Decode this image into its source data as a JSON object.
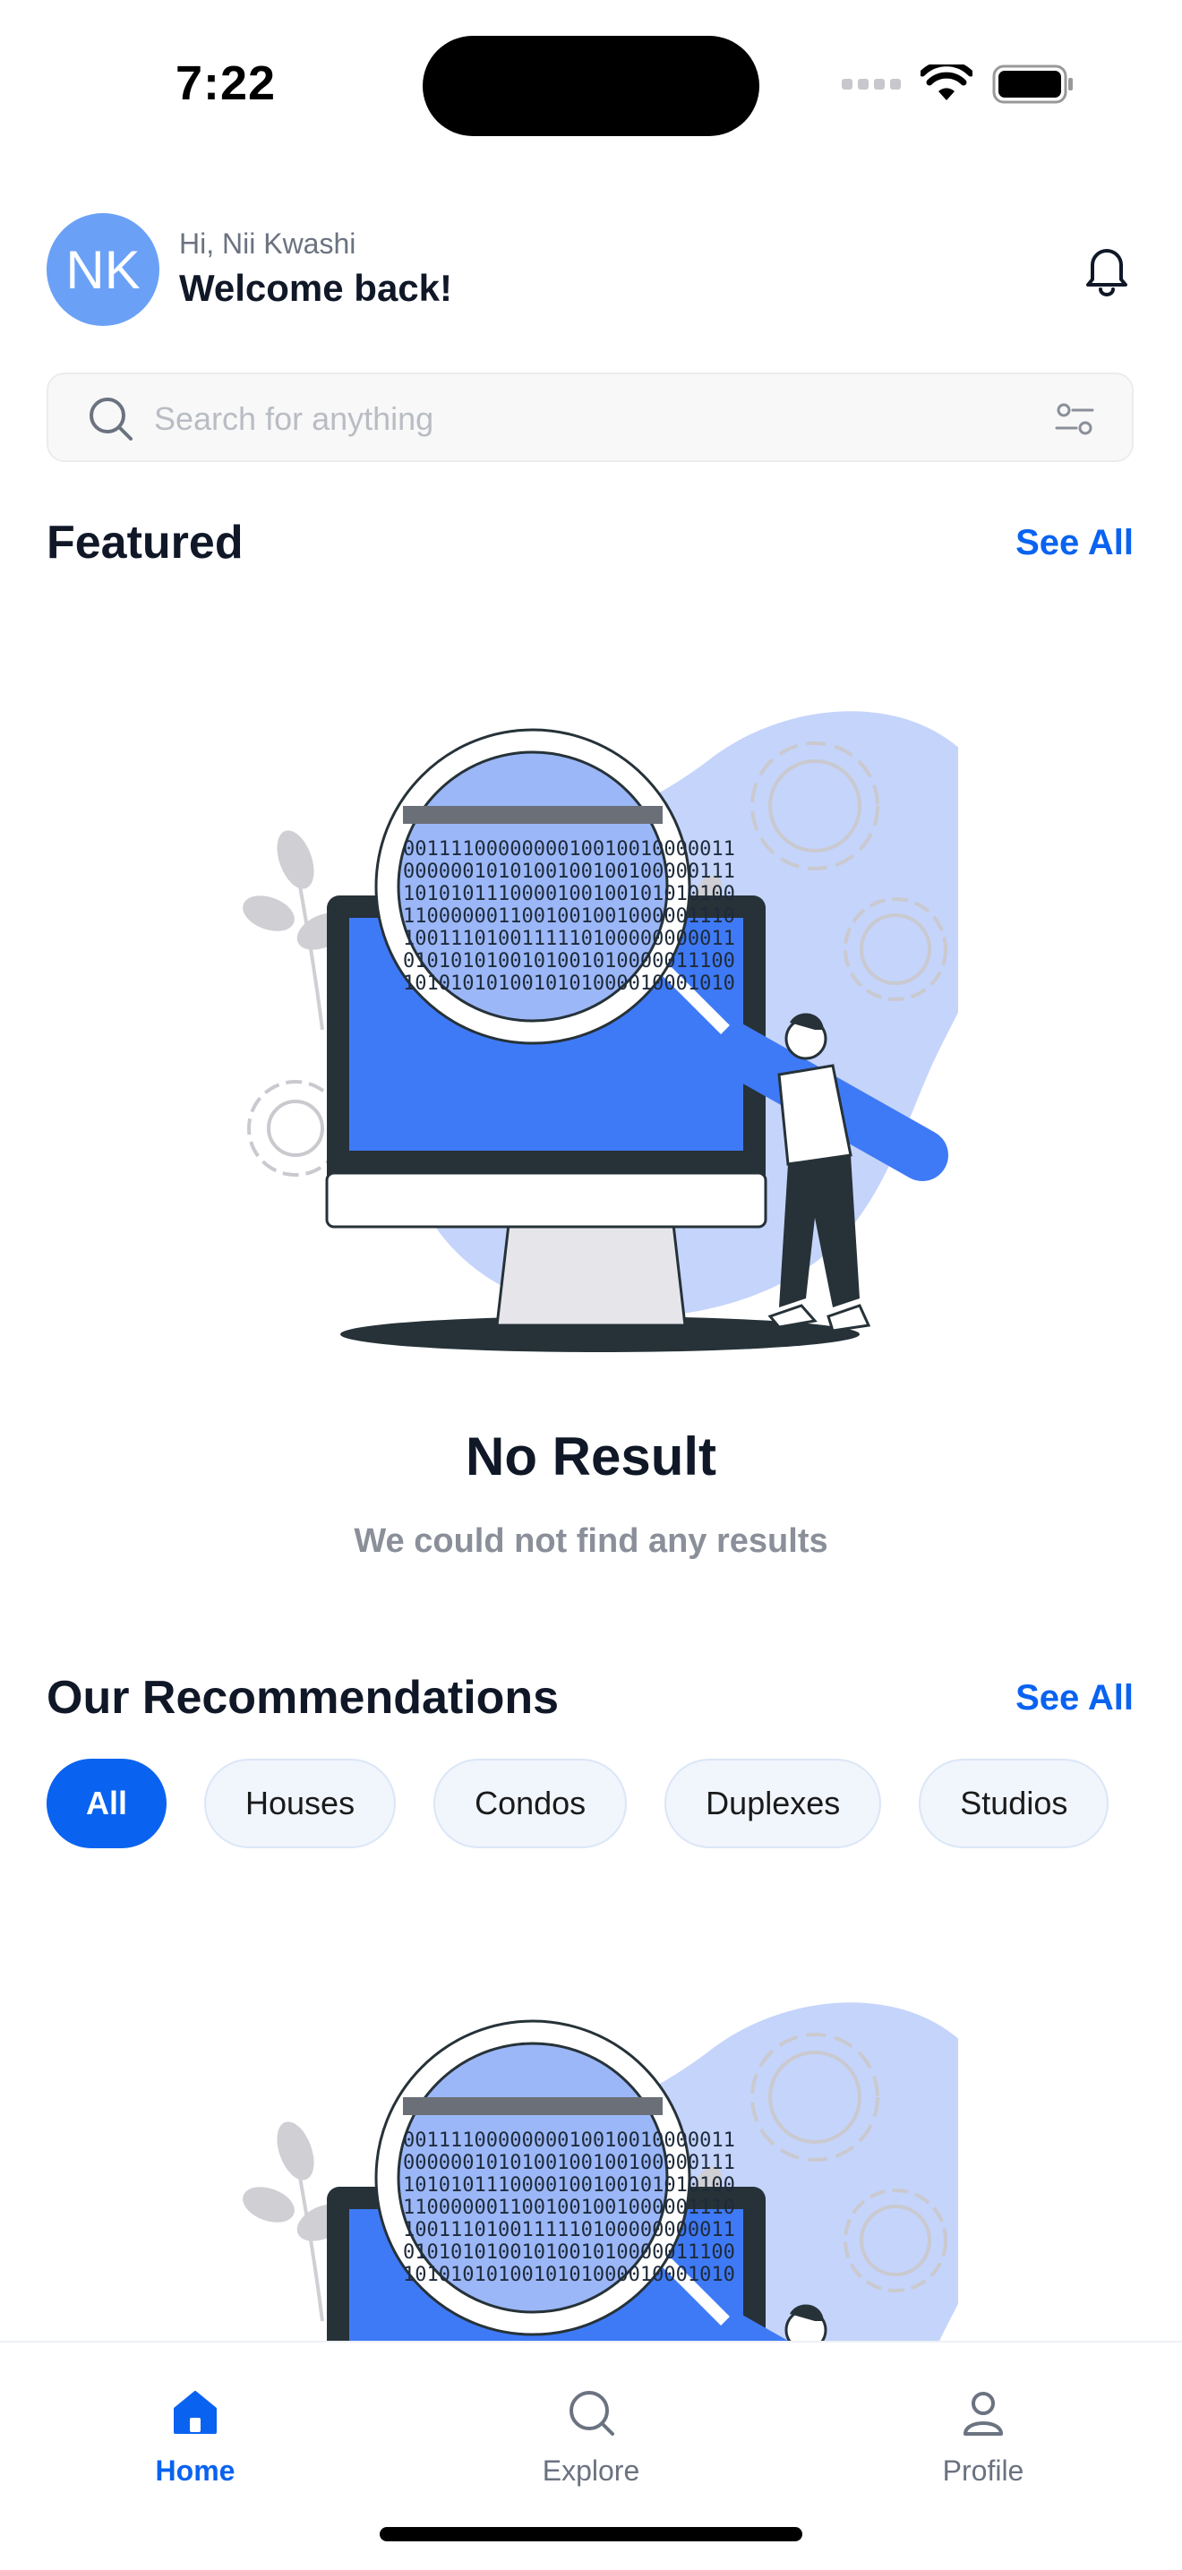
{
  "status_bar": {
    "time": "7:22"
  },
  "header": {
    "avatar_initials": "NK",
    "greeting": "Hi, Nii Kwashi",
    "welcome": "Welcome back!",
    "notification_icon": "bell-icon"
  },
  "search": {
    "placeholder": "Search for anything",
    "value": "",
    "filter_icon": "filter-sliders-icon"
  },
  "featured": {
    "title": "Featured",
    "see_all": "See All",
    "empty_title": "No Result",
    "empty_subtitle": "We could not find any results"
  },
  "recommendations": {
    "title": "Our Recommendations",
    "see_all": "See All",
    "filters": [
      "All",
      "Houses",
      "Condos",
      "Duplexes",
      "Studios"
    ],
    "selected_filter": "All"
  },
  "bottom_nav": {
    "items": [
      {
        "label": "Home",
        "icon": "home-icon",
        "active": true
      },
      {
        "label": "Explore",
        "icon": "search-icon",
        "active": false
      },
      {
        "label": "Profile",
        "icon": "user-icon",
        "active": false
      }
    ]
  },
  "colors": {
    "accent": "#0a63f0",
    "illustration_blob": "#c5d4fb",
    "illustration_screen": "#3f7af6"
  }
}
